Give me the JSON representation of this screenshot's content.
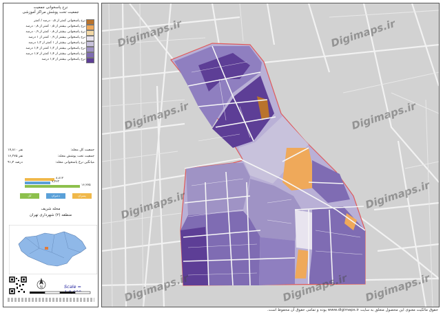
{
  "legend": {
    "title_line1": "نرخ پاسخوانی جمعیت",
    "title_line2": "جمعیت تحت پوشش مراکز آموزشی",
    "items": [
      {
        "label": "نرخ پاسخوانی کمتر از ۰٫۵ درصد / کمتر",
        "color": "#b9732c"
      },
      {
        "label": "نرخ پاسخوانی بیشتر از ۰٫۵ کمتر از ۰٫۸ درصد",
        "color": "#efa95a"
      },
      {
        "label": "نرخ پاسخوانی بیشتر از ۰٫۸ کمتر از ۰٫۹ درصد",
        "color": "#f3d8a6"
      },
      {
        "label": "نرخ پاسخوانی بیشتر از ۰٫۹ کمتر از ۱ درصد",
        "color": "#e8e4ef"
      },
      {
        "label": "نرخ پاسخوانی بیشتر از ۱ کمتر از ۱٫۲ درصد",
        "color": "#c8c2dc"
      },
      {
        "label": "نرخ پاسخوانی بیشتر از ۱٫۲ کمتر از ۱٫۴ درصد",
        "color": "#9f93c5"
      },
      {
        "label": "نرخ پاسخوانی بیشتر از ۱٫۴ کمتر از ۱٫۷ درصد",
        "color": "#7f6cb3"
      },
      {
        "label": "نرخ پاسخوانی بیشتر از ۱٫۷ درصد",
        "color": "#5d3e96"
      }
    ]
  },
  "stats": [
    {
      "label": "جمعیت کل محله:",
      "value": "۱۷,۸۱۰ نفر"
    },
    {
      "label": "جمعیت تحت پوشش محله:",
      "value": "۱۶,۲۷۵ نفر"
    },
    {
      "label": "میانگین نرخ پاسخوانی محله:",
      "value": "۹۱٫۴ درصد"
    }
  ],
  "bars": [
    {
      "value": "۸,۸۱۲",
      "color": "#f0b84a"
    },
    {
      "value": "۷,۴۶۳",
      "color": "#5aa0d8"
    },
    {
      "value": "۱۶,۲۷۵",
      "color": "#8dc04c"
    }
  ],
  "bar_boxes": [
    {
      "label": "پسران",
      "color": "#f0b84a"
    },
    {
      "label": "دختران",
      "color": "#5aa0d8"
    },
    {
      "label": "کل",
      "color": "#8dc04c"
    }
  ],
  "location": {
    "title_line1": "محله شریف",
    "title_line2": "منطقه (۲) شهرداری تهران"
  },
  "scale_text": "Scale = 1:9,000",
  "north_label": "N",
  "watermark": "Digimaps.ir",
  "footer": "حقوق مالکیت معنوی این محصول متعلق به سایت www.digimaps.ir بوده و تمامی حقوق آن محفوظ است.",
  "colors": {
    "boundary": "#e05a5a",
    "base": "#d2d2d2",
    "road": "#f7f7f7"
  }
}
